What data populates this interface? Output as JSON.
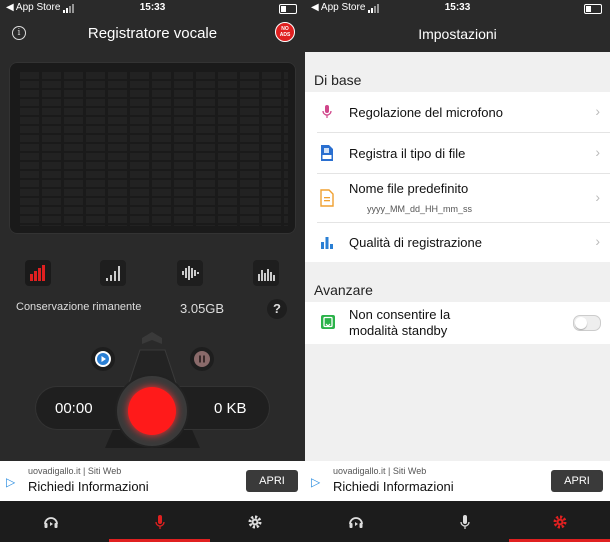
{
  "left": {
    "status": {
      "carrier": "◀ App Store",
      "time": "15:33"
    },
    "header": {
      "title": "Registratore vocale",
      "info_glyph": "i",
      "noads_line1": "NO",
      "noads_line2": "ADS"
    },
    "storage": {
      "label": "Conservazione rimanente",
      "value": "3.05GB",
      "help": "?"
    },
    "recorder": {
      "timer": "00:00",
      "size": "0 KB"
    },
    "ad": {
      "source": "uovadigallo.it | Siti Web",
      "title": "Richiedi Informazioni",
      "button": "APRI"
    },
    "tabs": [
      {
        "icon": "headphones-icon"
      },
      {
        "icon": "microphone-icon",
        "active": true
      },
      {
        "icon": "gear-icon"
      }
    ]
  },
  "right": {
    "status": {
      "carrier": "◀ App Store",
      "time": "15:33"
    },
    "header": {
      "title": "Impostazioni"
    },
    "section_basic": "Di base",
    "basic_items": [
      {
        "label": "Regolazione del microfono",
        "icon": "microphone-icon"
      },
      {
        "label": "Registra il tipo di file",
        "icon": "file-type-icon"
      },
      {
        "label": "Nome file predefinito",
        "sub": "yyyy_MM_dd_HH_mm_ss",
        "icon": "document-icon"
      },
      {
        "label": "Qualità di registrazione",
        "icon": "bar-chart-icon"
      }
    ],
    "section_advanced": "Avanzare",
    "advanced_items": [
      {
        "label_line1": "Non consentire la",
        "label_line2": "modalità standby",
        "icon": "standby-icon",
        "toggle": false
      }
    ],
    "ad": {
      "source": "uovadigallo.it | Siti Web",
      "title": "Richiedi Informazioni",
      "button": "APRI"
    },
    "tabs": [
      {
        "icon": "headphones-icon"
      },
      {
        "icon": "microphone-icon"
      },
      {
        "icon": "gear-icon",
        "active": true
      }
    ]
  },
  "colors": {
    "accent": "#e02020",
    "record": "#ff1a1a",
    "dark_bg": "#2a2a2a",
    "light_bg": "#f0f0f0"
  }
}
